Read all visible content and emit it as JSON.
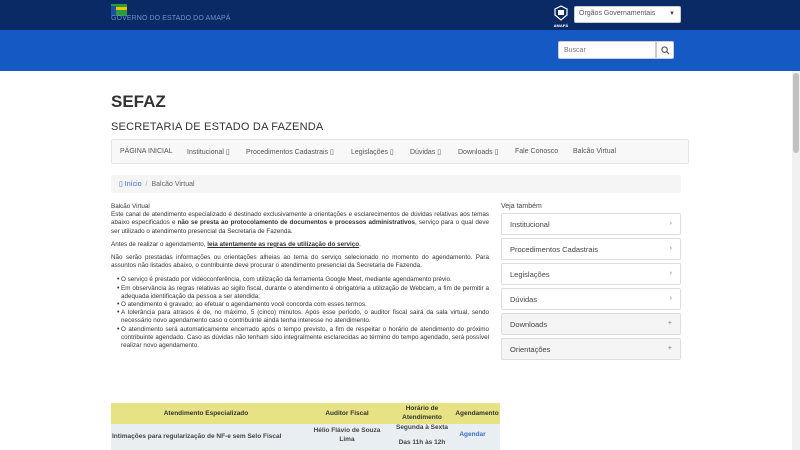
{
  "header": {
    "gov_name": "GOVERNO DO ESTADO DO AMAPÁ",
    "amapa_label": "AMAPÁ",
    "orgaos_label": "Órgãos Governamentais",
    "search_placeholder": "Buscar"
  },
  "page": {
    "title": "SEFAZ",
    "subtitle": "SECRETARIA DE ESTADO DA FAZENDA"
  },
  "nav": {
    "items": [
      {
        "label": "PÁGINA INICIAL"
      },
      {
        "label": "Institucional ▯"
      },
      {
        "label": "Procedimentos Cadastrais ▯"
      },
      {
        "label": "Legislações ▯"
      },
      {
        "label": "Dúvidas ▯"
      },
      {
        "label": "Downloads ▯"
      },
      {
        "label": "Fale Conosco"
      },
      {
        "label": "Balcão Virtual"
      }
    ]
  },
  "breadcrumb": {
    "home": "▯ Início",
    "separator": "/",
    "current": "Balcão Virtual"
  },
  "content": {
    "heading": "Balcão Virtual",
    "p1a": "Este canal de atendimento especializado é destinado exclusivamente a orientações e esclarecimentos de dúvidas relativas aos temas abaixo especificados e ",
    "p1b": "não se presta ao protocolamento de documentos e processos administrativos",
    "p1c": ", serviço para o qual deve ser utilizado o atendimento presencial da Secretaria de Fazenda.",
    "p2a": " Antes de realizar o agendamento, ",
    "p2b": "leia atentamente as regras de utilização do serviço",
    "p2c": ".",
    "p3": " Não serão prestadas informações ou orientações alheias ao tema do serviço selecionado no momento do agendamento. Para assuntos não listados abaixo, o contribuinte deve procurar o atendimento presencial da Secretaria de Fazenda.",
    "bullets": [
      "O serviço é prestado por videoconferência, com utilização da ferramenta Google Meet, mediante agendamento prévio.",
      "Em observância às regras relativas ao sigilo fiscal, durante o atendimento é obrigatória a utilização de Webcam, a fim de permitir a adequada identificação da pessoa a ser atendida;",
      "O atendimento é gravado; ao efetuar o agendamento você concorda com esses termos.",
      "A tolerância para atrasos é de, no máximo, 5 (cinco) minutos. Após esse período, o auditor fiscal sairá da sala virtual, sendo necessário novo agendamento caso o contribuinte ainda tenha interesse no atendimento.",
      "O atendimento será automaticamente encerrado após o tempo previsto, a fim de respeitar o horário de atendimento do próximo contribuinte agendado. Caso as dúvidas não tenham sido integralmente esclarecidas ao término do tempo agendado, será possível realizar novo agendamento."
    ]
  },
  "table": {
    "headers": {
      "col1": "Atendimento Especializado",
      "col2": "Auditor Fiscal",
      "col3a": "Horário de",
      "col3b": "Atendimento",
      "col4": "Agendamento"
    },
    "row": {
      "topic": "Intimações para regularização de NF-e sem Selo Fiscal",
      "auditor_a": "Hélio Flávio de Souza",
      "auditor_b": "Lima",
      "hours_a": "Segunda à Sexta",
      "hours_b": "Das 11h às 12h",
      "action": "Agendar"
    }
  },
  "sidebar": {
    "title": "Veja também",
    "items": [
      {
        "label": "Institucional",
        "indicator": "›"
      },
      {
        "label": "Procedimentos Cadastrais",
        "indicator": "›"
      },
      {
        "label": "Legislações",
        "indicator": "›"
      },
      {
        "label": "Dúvidas",
        "indicator": "›"
      },
      {
        "label": "Downloads",
        "indicator": "+"
      },
      {
        "label": "Orientações",
        "indicator": "+"
      }
    ]
  },
  "colors": {
    "topbar": "#0a2a66",
    "bluebar": "#1459c4",
    "table_header": "#e7e283",
    "link": "#3b6fc6"
  }
}
